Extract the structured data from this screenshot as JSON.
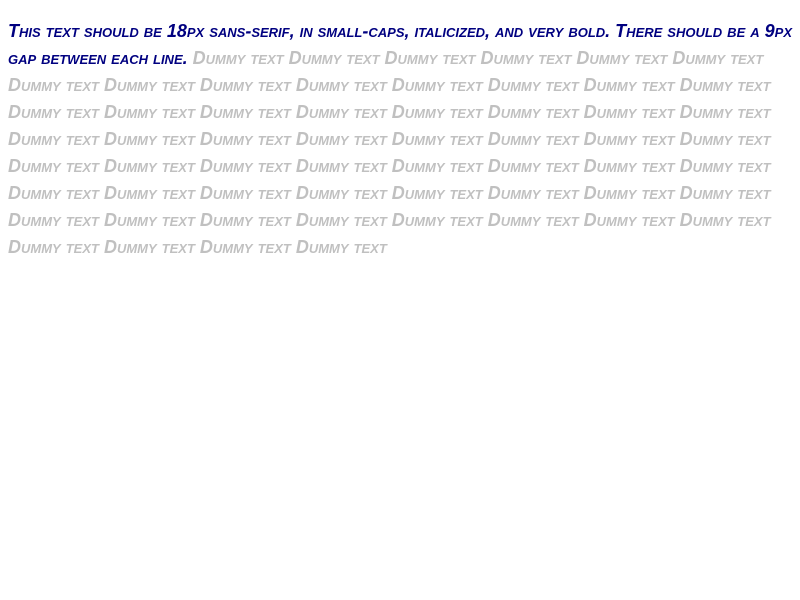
{
  "test": {
    "instruction": "This text should be 18px sans-serif, in small-caps, italicized, and very bold. There should be a 9px gap between each line.",
    "filler": "Dummy text Dummy text Dummy text Dummy text Dummy text Dummy text Dummy text Dummy text Dummy text Dummy text Dummy text Dummy text Dummy text Dummy text Dummy text Dummy text Dummy text Dummy text Dummy text Dummy text Dummy text Dummy text Dummy text Dummy text Dummy text Dummy text Dummy text Dummy text Dummy text Dummy text Dummy text Dummy text Dummy text Dummy text Dummy text Dummy text Dummy text Dummy text Dummy text Dummy text Dummy text Dummy text Dummy text Dummy text Dummy text Dummy text Dummy text Dummy text Dummy text Dummy text Dummy text Dummy text Dummy text Dummy text Dummy text Dummy text Dummy text Dummy text"
  },
  "colors": {
    "instruction": "#000080",
    "filler": "#c0c0c0",
    "background": "#ffffff"
  }
}
